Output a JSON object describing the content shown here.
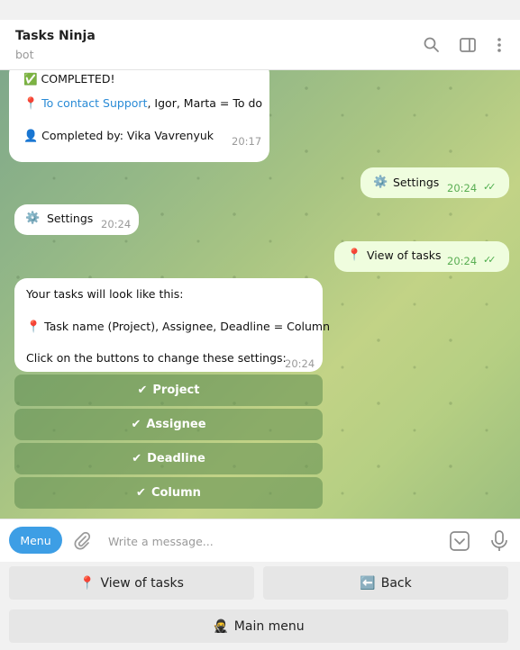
{
  "header": {
    "title": "Tasks Ninja",
    "subtitle": "bot"
  },
  "messages": {
    "m1": {
      "completed": "✅ COMPLETED!",
      "pin": "📍",
      "contact_link": "To contact Support",
      "contact_rest": ", Igor, Marta = To do",
      "user_icon": "👤",
      "completed_by": "Completed by: Vika Vavrenyuk",
      "time": "20:17"
    },
    "m2": {
      "icon": "⚙️",
      "text": "Settings",
      "time": "20:24"
    },
    "m3": {
      "icon": "⚙️",
      "text": "Settings",
      "time": "20:24"
    },
    "m4": {
      "icon": "📍",
      "text": "View of tasks",
      "time": "20:24"
    },
    "m5": {
      "line1": "Your tasks will look like this:",
      "pin": "📍",
      "line2": "Task name (Project), Assignee, Deadline = Column",
      "line3": "Click on the buttons to change these settings:",
      "time": "20:24"
    }
  },
  "inline_buttons": [
    {
      "check": "✔",
      "label": "Project"
    },
    {
      "check": "✔",
      "label": "Assignee"
    },
    {
      "check": "✔",
      "label": "Deadline"
    },
    {
      "check": "✔",
      "label": "Column"
    }
  ],
  "input": {
    "menu_label": "Menu",
    "placeholder": "Write a message..."
  },
  "keyboard": {
    "view_icon": "📍",
    "view_label": "View of tasks",
    "back_icon": "⬅️",
    "back_label": "Back",
    "main_icon": "🥷",
    "main_label": "Main menu"
  },
  "colors": {
    "accent": "#3d9ee5",
    "link": "#2a8bd6",
    "outgoing_bubble": "#effdde",
    "read_check": "#4fae4e"
  }
}
